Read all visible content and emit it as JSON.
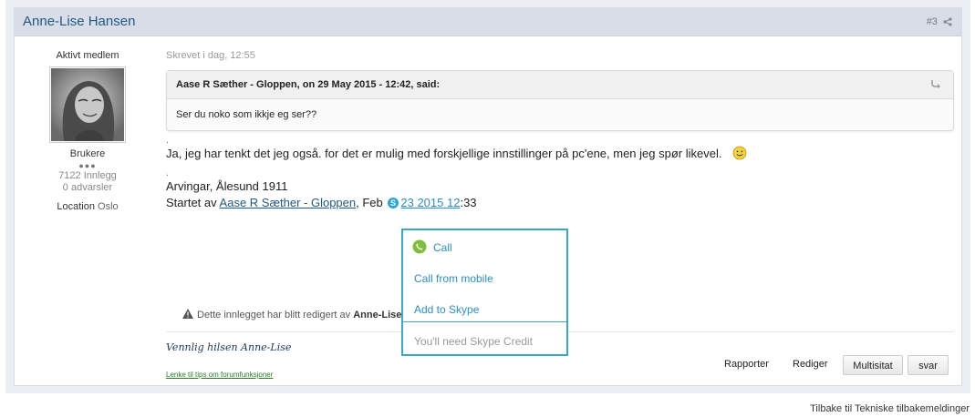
{
  "post": {
    "author": "Anne-Lise Hansen",
    "number": "#3",
    "member_group": "Aktivt medlem",
    "rank": "Brukere",
    "pips": "●●●",
    "post_count": "7122 Innlegg",
    "warnings": "0 advarsler",
    "location_label": "Location",
    "location_value": "Oslo",
    "posted": "Skrevet i dag, 12:55"
  },
  "quote": {
    "header": "Aase R Sæther - Gloppen, on 29 May 2015 - 12:42, said:",
    "body": "Ser du noko som ikkje eg ser??"
  },
  "body": {
    "dot1": ".",
    "line1": "Ja, jeg har tenkt det jeg også. for det er mulig med forskjellige innstillinger på pc'ene, men jeg spør likevel.",
    "emoji": "☺",
    "dot2": ".",
    "line2": "Arvingar, Ålesund 1911",
    "line3_prefix": "Startet av ",
    "line3_link": "Aase R Sæther - Gloppen",
    "line3_mid": ", Feb ",
    "line3_skype_link": "23 2015 12",
    "line3_suffix": ":33"
  },
  "edit_note": {
    "text": "Dette innlegget har blitt redigert av ",
    "editor": "Anne-Lise Ha"
  },
  "signature": "Vennlig hilsen Anne-Lise",
  "tips_link": "Lenke til tips om forumfunksjoner",
  "actions": {
    "report": "Rapporter",
    "edit": "Rediger",
    "multiquote": "Multisitat",
    "reply": "svar"
  },
  "skype_popup": {
    "call": "Call",
    "call_mobile": "Call from mobile",
    "add": "Add to Skype",
    "credit": "You'll need Skype Credit"
  },
  "footer": {
    "back_link": "Tilbake til Tekniske tilbakemeldinger"
  },
  "colors": {
    "header_bg": "#d8dde8",
    "link": "#225985",
    "skype_blue": "#3aa6c8",
    "call_green": "#7cbf3a"
  }
}
